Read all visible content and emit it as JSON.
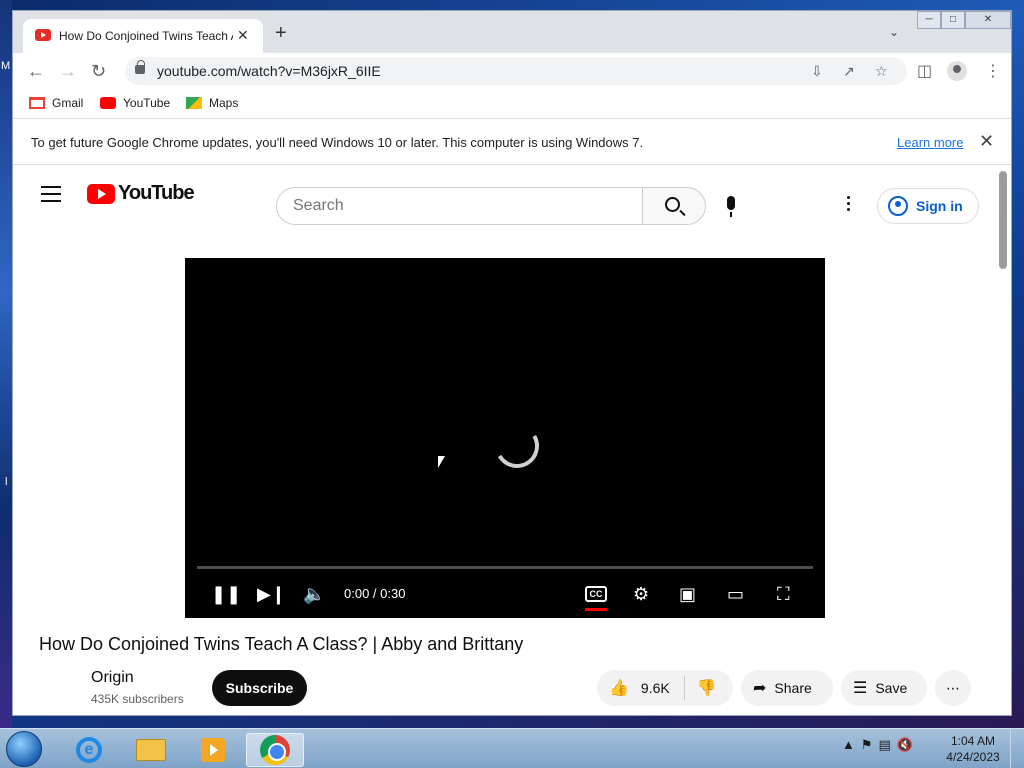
{
  "browser": {
    "tab_title": "How Do Conjoined Twins Teach A Class? | Abby and Brittany",
    "tab_close": "✕",
    "new_tab": "+",
    "url": "youtube.com/watch?v=M36jxR_6IIE",
    "bookmarks": [
      {
        "label": "Gmail"
      },
      {
        "label": "YouTube"
      },
      {
        "label": "Maps"
      }
    ],
    "infobar": {
      "message": "To get future Google Chrome updates, you'll need Windows 10 or later. This computer is using Windows 7.",
      "learn_more": "Learn more"
    }
  },
  "youtube": {
    "logo_text": "YouTube",
    "search_placeholder": "Search",
    "sign_in": "Sign in",
    "player": {
      "time": "0:00 / 0:30",
      "cc_label": "CC"
    },
    "video": {
      "title": "How Do Conjoined Twins Teach A Class? | Abby and Brittany",
      "channel": "Origin",
      "subscribers": "435K subscribers",
      "subscribe": "Subscribe",
      "likes": "9.6K",
      "share": "Share",
      "save": "Save"
    }
  },
  "taskbar": {
    "time": "1:04 AM",
    "date": "4/24/2023"
  },
  "desktop": {
    "left_label_top": "M",
    "left_label_bottom": "l"
  }
}
